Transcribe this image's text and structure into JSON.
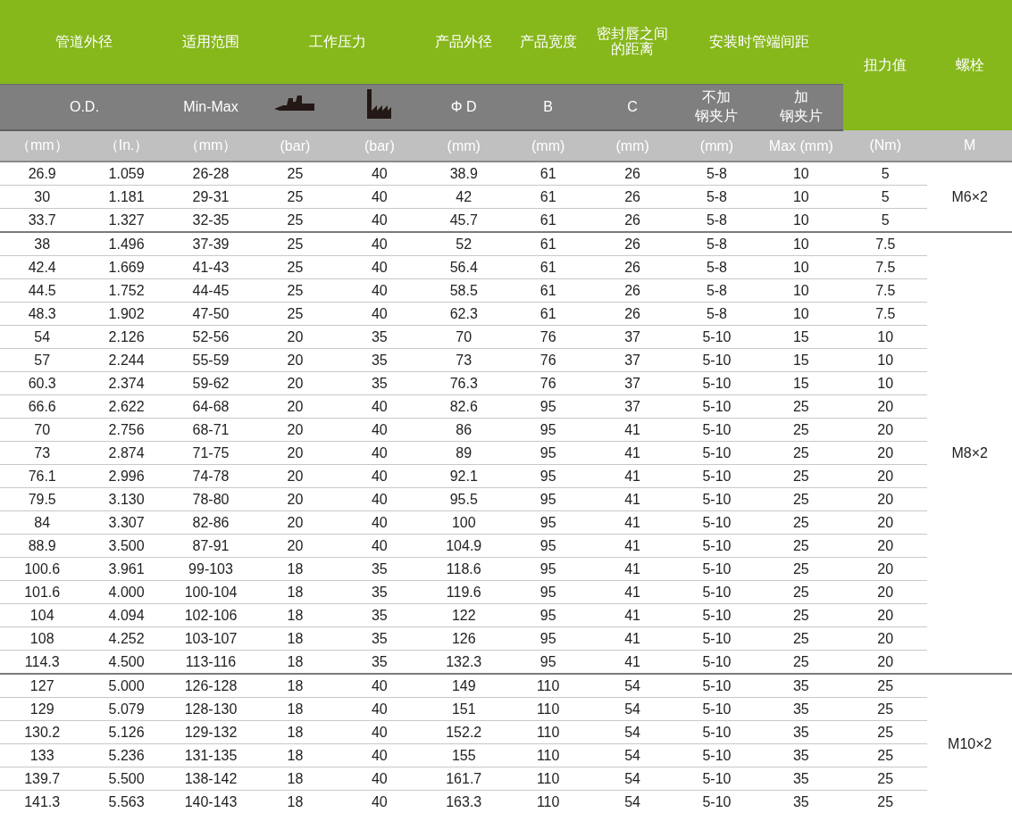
{
  "table": {
    "group_headers": [
      "管道外径",
      "适用范围",
      "工作压力",
      "产品外径",
      "产品宽度",
      "密封唇之间的距离",
      "安装时管端间距",
      "扭力值",
      "螺栓"
    ],
    "sub_headers": [
      {
        "kind": "text",
        "label": "O.D."
      },
      {
        "kind": "text",
        "label": "Min-Max"
      },
      {
        "kind": "ship"
      },
      {
        "kind": "factory"
      },
      {
        "kind": "text",
        "label": "Φ D"
      },
      {
        "kind": "text",
        "label": "B"
      },
      {
        "kind": "text",
        "label": "C"
      },
      {
        "kind": "lines",
        "lines": [
          "不加",
          "钢夹片"
        ]
      },
      {
        "kind": "lines",
        "lines": [
          "加",
          "钢夹片"
        ]
      }
    ],
    "units": [
      "（mm）",
      "（In.）",
      "（mm）",
      "(bar)",
      "(bar)",
      "(mm)",
      "(mm)",
      "(mm)",
      "(mm)",
      "Max (mm)",
      "(Nm)",
      "M"
    ],
    "groups": [
      {
        "bolt": "M6×2",
        "rows": [
          [
            "26.9",
            "1.059",
            "26-28",
            "25",
            "40",
            "38.9",
            "61",
            "26",
            "5-8",
            "10",
            "5"
          ],
          [
            "30",
            "1.181",
            "29-31",
            "25",
            "40",
            "42",
            "61",
            "26",
            "5-8",
            "10",
            "5"
          ],
          [
            "33.7",
            "1.327",
            "32-35",
            "25",
            "40",
            "45.7",
            "61",
            "26",
            "5-8",
            "10",
            "5"
          ]
        ]
      },
      {
        "bolt": "M8×2",
        "rows": [
          [
            "38",
            "1.496",
            "37-39",
            "25",
            "40",
            "52",
            "61",
            "26",
            "5-8",
            "10",
            "7.5"
          ],
          [
            "42.4",
            "1.669",
            "41-43",
            "25",
            "40",
            "56.4",
            "61",
            "26",
            "5-8",
            "10",
            "7.5"
          ],
          [
            "44.5",
            "1.752",
            "44-45",
            "25",
            "40",
            "58.5",
            "61",
            "26",
            "5-8",
            "10",
            "7.5"
          ],
          [
            "48.3",
            "1.902",
            "47-50",
            "25",
            "40",
            "62.3",
            "61",
            "26",
            "5-8",
            "10",
            "7.5"
          ],
          [
            "54",
            "2.126",
            "52-56",
            "20",
            "35",
            "70",
            "76",
            "37",
            "5-10",
            "15",
            "10"
          ],
          [
            "57",
            "2.244",
            "55-59",
            "20",
            "35",
            "73",
            "76",
            "37",
            "5-10",
            "15",
            "10"
          ],
          [
            "60.3",
            "2.374",
            "59-62",
            "20",
            "35",
            "76.3",
            "76",
            "37",
            "5-10",
            "15",
            "10"
          ],
          [
            "66.6",
            "2.622",
            "64-68",
            "20",
            "40",
            "82.6",
            "95",
            "37",
            "5-10",
            "25",
            "20"
          ],
          [
            "70",
            "2.756",
            "68-71",
            "20",
            "40",
            "86",
            "95",
            "41",
            "5-10",
            "25",
            "20"
          ],
          [
            "73",
            "2.874",
            "71-75",
            "20",
            "40",
            "89",
            "95",
            "41",
            "5-10",
            "25",
            "20"
          ],
          [
            "76.1",
            "2.996",
            "74-78",
            "20",
            "40",
            "92.1",
            "95",
            "41",
            "5-10",
            "25",
            "20"
          ],
          [
            "79.5",
            "3.130",
            "78-80",
            "20",
            "40",
            "95.5",
            "95",
            "41",
            "5-10",
            "25",
            "20"
          ],
          [
            "84",
            "3.307",
            "82-86",
            "20",
            "40",
            "100",
            "95",
            "41",
            "5-10",
            "25",
            "20"
          ],
          [
            "88.9",
            "3.500",
            "87-91",
            "20",
            "40",
            "104.9",
            "95",
            "41",
            "5-10",
            "25",
            "20"
          ],
          [
            "100.6",
            "3.961",
            "99-103",
            "18",
            "35",
            "118.6",
            "95",
            "41",
            "5-10",
            "25",
            "20"
          ],
          [
            "101.6",
            "4.000",
            "100-104",
            "18",
            "35",
            "119.6",
            "95",
            "41",
            "5-10",
            "25",
            "20"
          ],
          [
            "104",
            "4.094",
            "102-106",
            "18",
            "35",
            "122",
            "95",
            "41",
            "5-10",
            "25",
            "20"
          ],
          [
            "108",
            "4.252",
            "103-107",
            "18",
            "35",
            "126",
            "95",
            "41",
            "5-10",
            "25",
            "20"
          ],
          [
            "114.3",
            "4.500",
            "113-116",
            "18",
            "35",
            "132.3",
            "95",
            "41",
            "5-10",
            "25",
            "20"
          ]
        ]
      },
      {
        "bolt": "M10×2",
        "rows": [
          [
            "127",
            "5.000",
            "126-128",
            "18",
            "40",
            "149",
            "110",
            "54",
            "5-10",
            "35",
            "25"
          ],
          [
            "129",
            "5.079",
            "128-130",
            "18",
            "40",
            "151",
            "110",
            "54",
            "5-10",
            "35",
            "25"
          ],
          [
            "130.2",
            "5.126",
            "129-132",
            "18",
            "40",
            "152.2",
            "110",
            "54",
            "5-10",
            "35",
            "25"
          ],
          [
            "133",
            "5.236",
            "131-135",
            "18",
            "40",
            "155",
            "110",
            "54",
            "5-10",
            "35",
            "25"
          ],
          [
            "139.7",
            "5.500",
            "138-142",
            "18",
            "40",
            "161.7",
            "110",
            "54",
            "5-10",
            "35",
            "25"
          ],
          [
            "141.3",
            "5.563",
            "140-143",
            "18",
            "40",
            "163.3",
            "110",
            "54",
            "5-10",
            "35",
            "25"
          ]
        ]
      }
    ]
  }
}
